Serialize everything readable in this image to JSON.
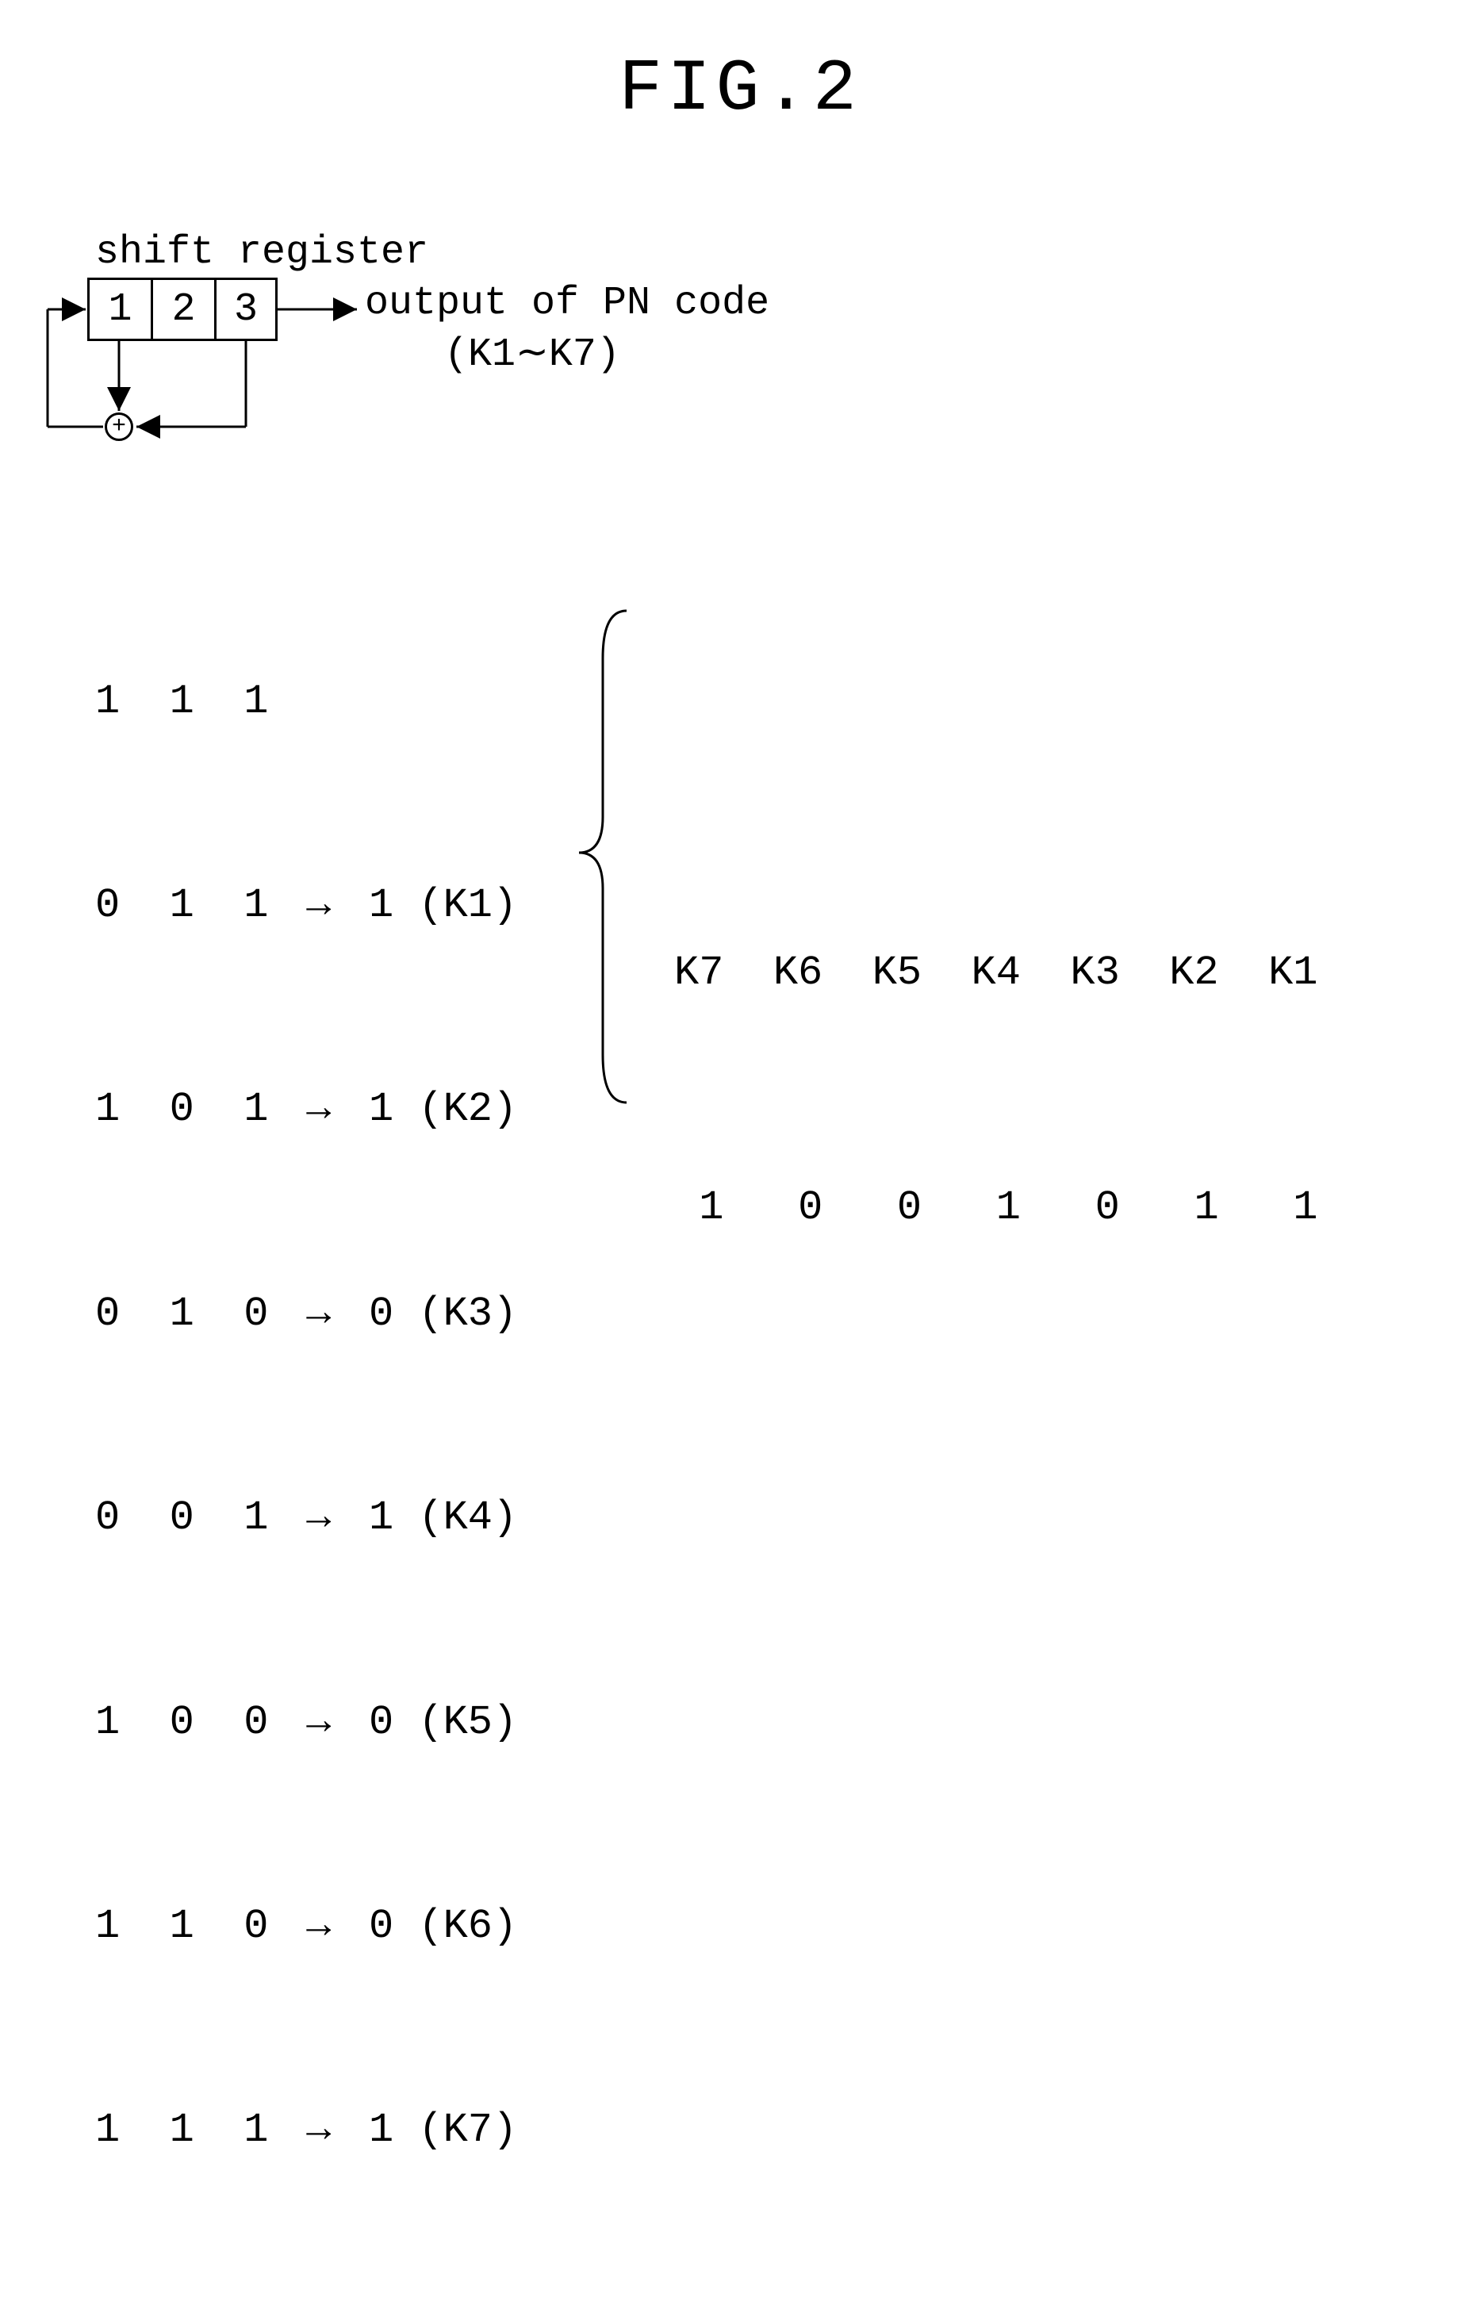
{
  "title": "FIG.2",
  "shift_register": {
    "label": "shift register",
    "cells": [
      "1",
      "2",
      "3"
    ],
    "output_line1": "output of PN code",
    "output_line2": "(K1∼K7)",
    "adder_symbol": "+"
  },
  "states": [
    {
      "bits": [
        "1",
        "1",
        "1"
      ],
      "out": "",
      "tag": ""
    },
    {
      "bits": [
        "0",
        "1",
        "1"
      ],
      "out": "1",
      "tag": "(K1)"
    },
    {
      "bits": [
        "1",
        "0",
        "1"
      ],
      "out": "1",
      "tag": "(K2)"
    },
    {
      "bits": [
        "0",
        "1",
        "0"
      ],
      "out": "0",
      "tag": "(K3)"
    },
    {
      "bits": [
        "0",
        "0",
        "1"
      ],
      "out": "1",
      "tag": "(K4)"
    },
    {
      "bits": [
        "1",
        "0",
        "0"
      ],
      "out": "0",
      "tag": "(K5)"
    },
    {
      "bits": [
        "1",
        "1",
        "0"
      ],
      "out": "0",
      "tag": "(K6)"
    },
    {
      "bits": [
        "1",
        "1",
        "1"
      ],
      "out": "1",
      "tag": "(K7)"
    }
  ],
  "result": {
    "headers": [
      "K7",
      "K6",
      "K5",
      "K4",
      "K3",
      "K2",
      "K1"
    ],
    "values": [
      "1",
      "0",
      "0",
      "1",
      "0",
      "1",
      "1"
    ]
  },
  "chart_data": {
    "type": "table",
    "description": "3-stage LFSR (linear feedback shift register) with XOR feedback of stage 1 and stage 3, generating PN code output K1 through K7",
    "register_stages": 3,
    "feedback_taps": [
      1,
      3
    ],
    "initial_state": [
      1,
      1,
      1
    ],
    "state_sequence": [
      {
        "reg": [
          1,
          1,
          1
        ],
        "output_bit": null,
        "label": null
      },
      {
        "reg": [
          0,
          1,
          1
        ],
        "output_bit": 1,
        "label": "K1"
      },
      {
        "reg": [
          1,
          0,
          1
        ],
        "output_bit": 1,
        "label": "K2"
      },
      {
        "reg": [
          0,
          1,
          0
        ],
        "output_bit": 0,
        "label": "K3"
      },
      {
        "reg": [
          0,
          0,
          1
        ],
        "output_bit": 1,
        "label": "K4"
      },
      {
        "reg": [
          1,
          0,
          0
        ],
        "output_bit": 0,
        "label": "K5"
      },
      {
        "reg": [
          1,
          1,
          0
        ],
        "output_bit": 0,
        "label": "K6"
      },
      {
        "reg": [
          1,
          1,
          1
        ],
        "output_bit": 1,
        "label": "K7"
      }
    ],
    "pn_code_order": [
      "K7",
      "K6",
      "K5",
      "K4",
      "K3",
      "K2",
      "K1"
    ],
    "pn_code_bits": [
      1,
      0,
      0,
      1,
      0,
      1,
      1
    ]
  }
}
